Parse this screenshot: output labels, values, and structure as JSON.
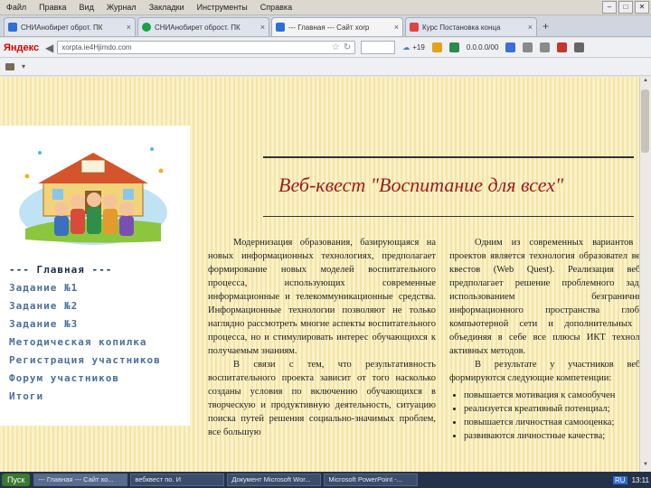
{
  "menubar": {
    "items": [
      "Файл",
      "Правка",
      "Вид",
      "Журнал",
      "Закладки",
      "Инструменты",
      "Справка"
    ]
  },
  "tabs": [
    {
      "label": "СНИАнобирет оброт. ПК",
      "color": "#2f6fd6",
      "active": false
    },
    {
      "label": "СНИАнобирет оброст. ПК",
      "color": "#1aa146",
      "active": false
    },
    {
      "label": "--- Главная --- Сайт xorp",
      "color": "#2f6fd6",
      "active": true
    },
    {
      "label": "Курс Постановка конца",
      "color": "#d44",
      "active": false
    }
  ],
  "navbar": {
    "brand": "Яндекс",
    "url": "xorpta.ie4Hjimdo.com",
    "counter": "+19",
    "weather": "0.0.0.0/00",
    "brand_color": "#dd0000"
  },
  "page": {
    "title": "Веб-квест \"Воспитание для всех\"",
    "menu": [
      "--- Главная ---",
      "Задание №1",
      "Задание №2",
      "Задание №3",
      "Методическая копилка",
      "Регистрация участников",
      "Форум участников",
      "Итоги"
    ],
    "col1": [
      "Модернизация образования, базирующаяся на новых информационных технологиях, предполагает формирование новых моделей воспитательного процесса, использующих современные информационные и телекоммуникационные средства. Информационные технологии позволяют не только наглядно рассмотреть многие аспекты воспитательного процесса, но и стимулировать интерес обучающихся к получаемым знаниям.",
      "В связи с тем, что результативность воспитательного проекта зависит от того насколько созданы условия по включению обучающихся в творческую и продуктивную деятельность, ситуацию поиска путей решения социально-значимых проблем, все большую"
    ],
    "col2_paragraphs": [
      "Одним из современных вариантов м проектов является технология образовател веб-квестов (Web Quest). Реализация веб-к предполагает решение проблемного задан использованием безграничных информационного пространства глобал компьютерной сети и дополнительных и объединяя в себе все плюсы ИКТ технолог активных методов.",
      "В результате у участников веб-к формируются следующие компетенции:"
    ],
    "col2_bullets": [
      "повышается мотивация к самообучен",
      "реализуется креативный потенциал;",
      "повышается личностная самооценка;",
      "развиваются личностные качества;"
    ]
  },
  "taskbar": {
    "start": "Пуск",
    "tasks": [
      {
        "label": "--- Главная --- Сайт хо...",
        "active": true
      },
      {
        "label": "вебквест по. И",
        "active": false
      },
      {
        "label": "Документ Microsoft Wor...",
        "active": false
      },
      {
        "label": "Microsoft PowerPoint -...",
        "active": false
      }
    ],
    "lang": "RU",
    "time": "13:11"
  }
}
